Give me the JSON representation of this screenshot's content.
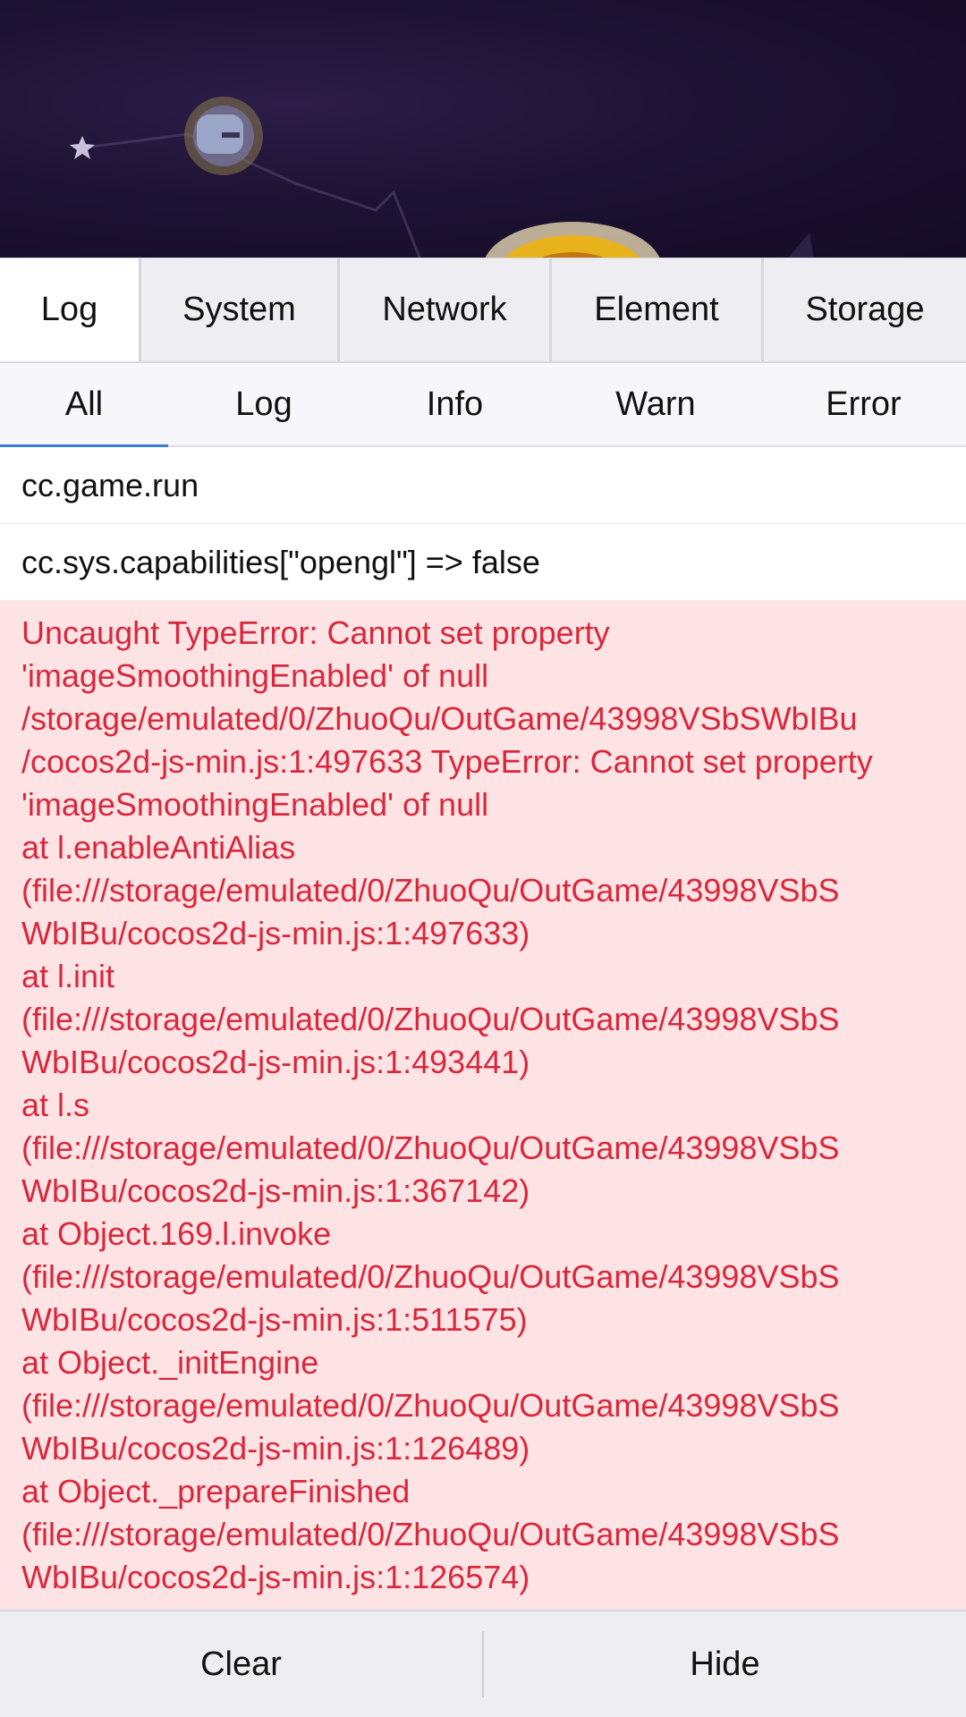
{
  "tabs": [
    "Log",
    "System",
    "Network",
    "Element",
    "Storage"
  ],
  "filters": [
    "All",
    "Log",
    "Info",
    "Warn",
    "Error"
  ],
  "logs": {
    "entry1": "cc.game.run",
    "entry2": "cc.sys.capabilities[\"opengl\"] => false",
    "error_lines": [
      "Uncaught TypeError: Cannot set property",
      "'imageSmoothingEnabled' of null",
      "/storage/emulated/0/ZhuoQu/OutGame/43998VSbSWbIBu",
      "/cocos2d-js-min.js:1:497633 TypeError: Cannot set property",
      "'imageSmoothingEnabled' of null",
      "at l.enableAntiAlias",
      "(file:///storage/emulated/0/ZhuoQu/OutGame/43998VSbS",
      "WbIBu/cocos2d-js-min.js:1:497633)",
      "at l.init",
      "(file:///storage/emulated/0/ZhuoQu/OutGame/43998VSbS",
      "WbIBu/cocos2d-js-min.js:1:493441)",
      "at l.s",
      "(file:///storage/emulated/0/ZhuoQu/OutGame/43998VSbS",
      "WbIBu/cocos2d-js-min.js:1:367142)",
      "at Object.169.l.invoke",
      "(file:///storage/emulated/0/ZhuoQu/OutGame/43998VSbS",
      "WbIBu/cocos2d-js-min.js:1:511575)",
      "at Object._initEngine",
      "(file:///storage/emulated/0/ZhuoQu/OutGame/43998VSbS",
      "WbIBu/cocos2d-js-min.js:1:126489)",
      "at Object._prepareFinished",
      "(file:///storage/emulated/0/ZhuoQu/OutGame/43998VSbS",
      "WbIBu/cocos2d-js-min.js:1:126574)"
    ]
  },
  "bottom": {
    "clear_label": "Clear",
    "hide_label": "Hide"
  },
  "colors": {
    "error_text": "#d8283d",
    "error_bg": "#fde3e3",
    "active_indicator": "#3a7bd5",
    "game_bg": "#1d1233"
  },
  "icons": [
    "star-icon",
    "sun-character-icon"
  ]
}
